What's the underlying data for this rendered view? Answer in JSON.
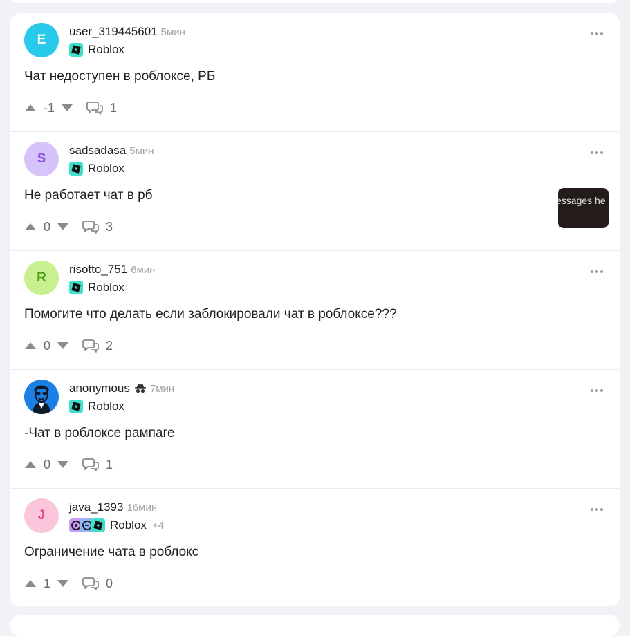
{
  "posts": [
    {
      "avatar_letter": "E",
      "avatar_bg": "#29c9ea",
      "avatar_fg": "#ffffff",
      "username": "user_319445601",
      "time": "5мин",
      "tag": "Roblox",
      "title": "Чат недоступен в роблоксе, РБ",
      "votes": "-1",
      "comments": "1"
    },
    {
      "avatar_letter": "S",
      "avatar_bg": "#d7c3fb",
      "avatar_fg": "#8c4fe0",
      "username": "sadsadasa",
      "time": "5мин",
      "tag": "Roblox",
      "title": "Не работает чат в рб",
      "votes": "0",
      "comments": "3",
      "thumbnail_text": "essages he"
    },
    {
      "avatar_letter": "R",
      "avatar_bg": "#c9f090",
      "avatar_fg": "#4a9a1c",
      "username": "risotto_751",
      "time": "6мин",
      "tag": "Roblox",
      "title": "Помогите что делать если заблокировали чат в роблоксе???",
      "votes": "0",
      "comments": "2"
    },
    {
      "avatar_bg": "#1b7fe6",
      "username": "anonymous",
      "time": "7мин",
      "tag": "Roblox",
      "title": "-Чат в роблоксе рампаге",
      "votes": "0",
      "comments": "1"
    },
    {
      "avatar_letter": "J",
      "avatar_bg": "#fbc6dc",
      "avatar_fg": "#e04b7e",
      "username": "java_1393",
      "time": "16мин",
      "tag": "Roblox",
      "tag_more": "+4",
      "title": "Ограничение чата в роблокс",
      "votes": "1",
      "comments": "0"
    }
  ],
  "icons": {
    "upvote": "arrow-up-icon",
    "downvote": "arrow-down-icon",
    "comments": "comment-bubbles-icon",
    "menu": "more-dots-icon",
    "tag": "roblox-icon",
    "anonymous": "spy-icon"
  },
  "colors": {
    "roblox_tag": "#3fe0c9",
    "muted": "#a3a3a8"
  }
}
